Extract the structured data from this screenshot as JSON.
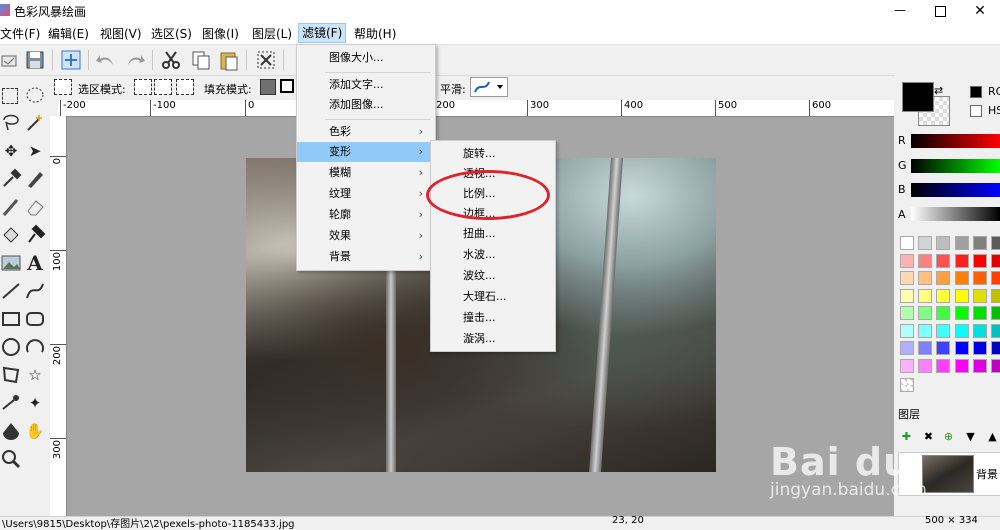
{
  "window": {
    "title": "色彩风暴绘画",
    "minimize": "—",
    "close": "✕"
  },
  "menubar": [
    {
      "label": "文件(F)"
    },
    {
      "label": "编辑(E)"
    },
    {
      "label": "视图(V)"
    },
    {
      "label": "选区(S)"
    },
    {
      "label": "图像(I)"
    },
    {
      "label": "图层(L)"
    },
    {
      "label": "滤镜(F)"
    },
    {
      "label": "帮助(H)"
    }
  ],
  "optionbar": {
    "select_mode_label": "选区模式:",
    "fill_mode_label": "填充模式:",
    "smooth_label": "平滑:"
  },
  "ruler": {
    "h": [
      "-200",
      "-100",
      "0",
      "100",
      "200",
      "300",
      "400",
      "500",
      "600"
    ],
    "v": [
      "0",
      "100",
      "200",
      "300"
    ]
  },
  "filter_menu": {
    "items": [
      "图像大小...",
      "添加文字...",
      "添加图像...",
      "色彩",
      "变形",
      "模糊",
      "纹理",
      "轮廓",
      "效果",
      "背景"
    ],
    "highlighted": "变形"
  },
  "transform_submenu": {
    "items": [
      "旋转...",
      "透视...",
      "比例...",
      "边框...",
      "扭曲...",
      "水波...",
      "波纹...",
      "大理石...",
      "撞击...",
      "漩涡..."
    ],
    "annotated": "比例..."
  },
  "colors": {
    "r_label": "R",
    "g_label": "G",
    "b_label": "B",
    "a_label": "A",
    "rgb_option": "RG",
    "hsv_option": "HS",
    "palette": [
      "#ffffff",
      "#d4d4d4",
      "#bdbdbd",
      "#a0a0a0",
      "#808080",
      "#5a5a5a",
      "#303030",
      "#ffb0b0",
      "#ff8080",
      "#ff5050",
      "#ff2020",
      "#ff0000",
      "#e00000",
      "#c00000",
      "#ffd8b0",
      "#ffc080",
      "#ffa040",
      "#ff8000",
      "#ff6000",
      "#ff4000",
      "#e03000",
      "#ffffb0",
      "#ffff80",
      "#ffff40",
      "#ffff00",
      "#e0e000",
      "#c0c000",
      "#a0a000",
      "#b0ffb0",
      "#80ff80",
      "#40ff40",
      "#00ff00",
      "#00e000",
      "#00c000",
      "#00a000",
      "#b0ffff",
      "#80ffff",
      "#40ffff",
      "#00ffff",
      "#00e0e0",
      "#00c0c0",
      "#00a0a0",
      "#b0b0ff",
      "#8080ff",
      "#4040ff",
      "#0000ff",
      "#0000e0",
      "#0000c0",
      "#0000a0",
      "#ffb0ff",
      "#ff80ff",
      "#ff40ff",
      "#ff00ff",
      "#e000e0",
      "#c000c0",
      "#a000a0"
    ]
  },
  "layers": {
    "title": "图层",
    "layer_name": "背景"
  },
  "statusbar": {
    "path": "\\Users\\9815\\Desktop\\存图片\\2\\2\\pexels-photo-1185433.jpg",
    "coords": "23, 20",
    "size": "500 × 334"
  },
  "watermark": {
    "brand": "Bai du",
    "sub": "jingyan.baidu.com"
  }
}
